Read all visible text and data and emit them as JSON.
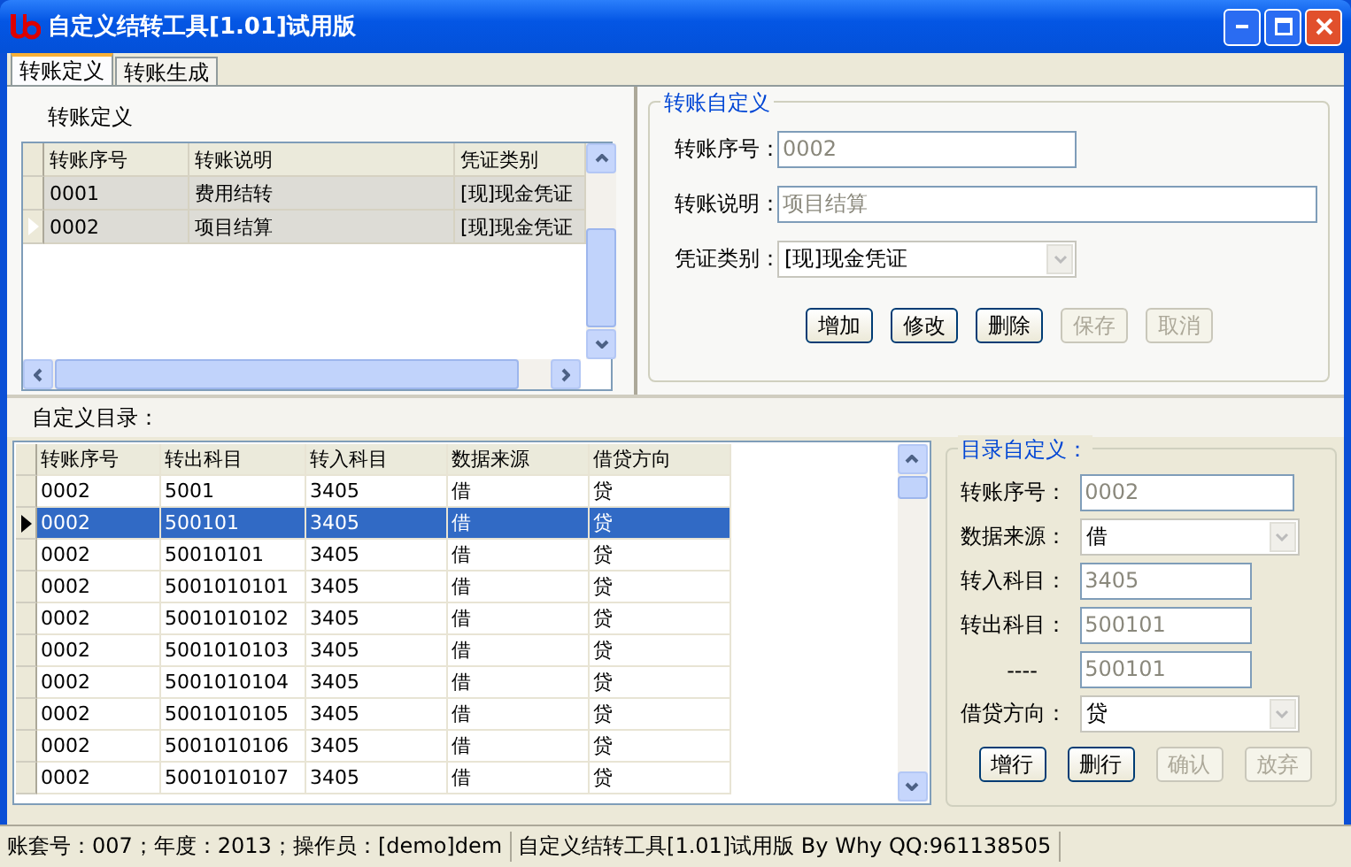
{
  "window": {
    "title": "自定义结转工具[1.01]试用版"
  },
  "tabs": [
    {
      "label": "转账定义",
      "selected": true
    },
    {
      "label": "转账生成",
      "selected": false
    }
  ],
  "definition_grid": {
    "title": "转账定义",
    "columns": [
      "转账序号",
      "转账说明",
      "凭证类别"
    ],
    "rows": [
      {
        "cells": [
          "0001",
          "费用结转",
          "[现]现金凭证"
        ],
        "selected": false
      },
      {
        "cells": [
          "0002",
          "项目结算",
          "[现]现金凭证"
        ],
        "selected": true
      }
    ]
  },
  "transfer_form": {
    "title": "转账自定义",
    "fields": [
      {
        "label": "转账序号：",
        "value": "0002",
        "kind": "short"
      },
      {
        "label": "转账说明：",
        "value": "项目结算",
        "kind": "long"
      },
      {
        "label": "凭证类别：",
        "value": "[现]现金凭证",
        "kind": "select"
      }
    ],
    "buttons": [
      {
        "label": "增加",
        "disabled": false
      },
      {
        "label": "修改",
        "disabled": false
      },
      {
        "label": "删除",
        "disabled": false
      },
      {
        "label": "保存",
        "disabled": true
      },
      {
        "label": "取消",
        "disabled": true
      }
    ]
  },
  "catalog": {
    "title": "自定义目录：",
    "columns": [
      "转账序号",
      "转出科目",
      "转入科目",
      "数据来源",
      "借贷方向"
    ],
    "rows": [
      {
        "cells": [
          "0002",
          "5001",
          "3405",
          "借",
          "贷"
        ],
        "selected": false
      },
      {
        "cells": [
          "0002",
          "500101",
          "3405",
          "借",
          "贷"
        ],
        "selected": true
      },
      {
        "cells": [
          "0002",
          "50010101",
          "3405",
          "借",
          "贷"
        ],
        "selected": false
      },
      {
        "cells": [
          "0002",
          "5001010101",
          "3405",
          "借",
          "贷"
        ],
        "selected": false
      },
      {
        "cells": [
          "0002",
          "5001010102",
          "3405",
          "借",
          "贷"
        ],
        "selected": false
      },
      {
        "cells": [
          "0002",
          "5001010103",
          "3405",
          "借",
          "贷"
        ],
        "selected": false
      },
      {
        "cells": [
          "0002",
          "5001010104",
          "3405",
          "借",
          "贷"
        ],
        "selected": false
      },
      {
        "cells": [
          "0002",
          "5001010105",
          "3405",
          "借",
          "贷"
        ],
        "selected": false
      },
      {
        "cells": [
          "0002",
          "5001010106",
          "3405",
          "借",
          "贷"
        ],
        "selected": false
      },
      {
        "cells": [
          "0002",
          "5001010107",
          "3405",
          "借",
          "贷"
        ],
        "selected": false
      }
    ]
  },
  "catalog_form": {
    "title": "目录自定义：",
    "fields": [
      {
        "label": "转账序号：",
        "value": "0002",
        "kind": "long"
      },
      {
        "label": "数据来源：",
        "value": "借",
        "kind": "select"
      },
      {
        "label": "转入科目：",
        "value": "3405",
        "kind": "short"
      },
      {
        "label": "转出科目：",
        "value": "500101",
        "kind": "short"
      },
      {
        "label": "----",
        "value": "500101",
        "kind": "short"
      },
      {
        "label": "借贷方向：",
        "value": "贷",
        "kind": "select"
      }
    ],
    "buttons": [
      {
        "label": "增行",
        "disabled": false
      },
      {
        "label": "删行",
        "disabled": false
      },
      {
        "label": "确认",
        "disabled": true
      },
      {
        "label": "放弃",
        "disabled": true
      }
    ]
  },
  "status_bar": [
    "账套号：007；年度：2013；操作员：[demo]dem",
    "自定义结转工具[1.01]试用版 By Why QQ:961138505"
  ]
}
